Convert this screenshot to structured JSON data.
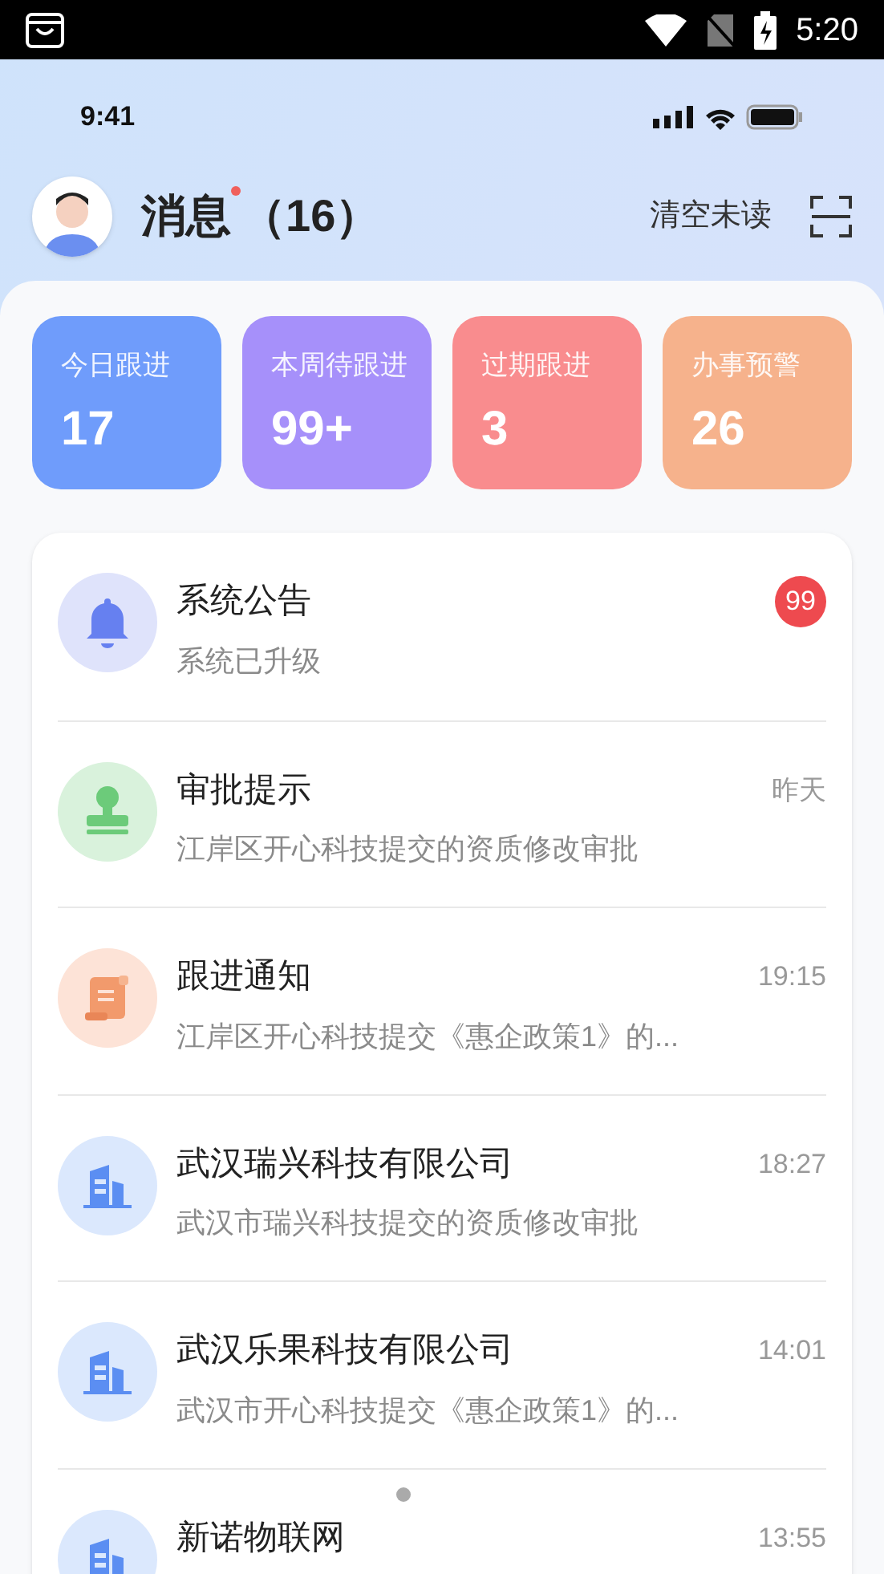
{
  "system_bar": {
    "time": "5:20"
  },
  "phone_status": {
    "time": "9:41"
  },
  "header": {
    "title": "消息",
    "count": "（16）",
    "unread_dot": true,
    "action": "清空未读"
  },
  "stats": [
    {
      "label": "今日跟进",
      "value": "17",
      "color": "#6f9cfb"
    },
    {
      "label": "本周待跟进",
      "value": "99+",
      "color": "#a690fa"
    },
    {
      "label": "过期跟进",
      "value": "3",
      "color": "#f98c8e"
    },
    {
      "label": "办事预警",
      "value": "26",
      "color": "#f6b28c"
    }
  ],
  "messages": [
    {
      "kind": "bell",
      "title": "系统公告",
      "subtitle": "系统已升级",
      "badge": "99"
    },
    {
      "kind": "stamp",
      "title": "审批提示",
      "subtitle": "江岸区开心科技提交的资质修改审批",
      "time": "昨天"
    },
    {
      "kind": "scroll",
      "title": "跟进通知",
      "subtitle": "江岸区开心科技提交《惠企政策1》的...",
      "time": "19:15"
    },
    {
      "kind": "building",
      "title": "武汉瑞兴科技有限公司",
      "subtitle": "武汉市瑞兴科技提交的资质修改审批",
      "time": "18:27"
    },
    {
      "kind": "building",
      "title": "武汉乐果科技有限公司",
      "subtitle": "武汉市开心科技提交《惠企政策1》的...",
      "time": "14:01"
    },
    {
      "kind": "building",
      "title": "新诺物联网",
      "time": "13:55"
    }
  ]
}
